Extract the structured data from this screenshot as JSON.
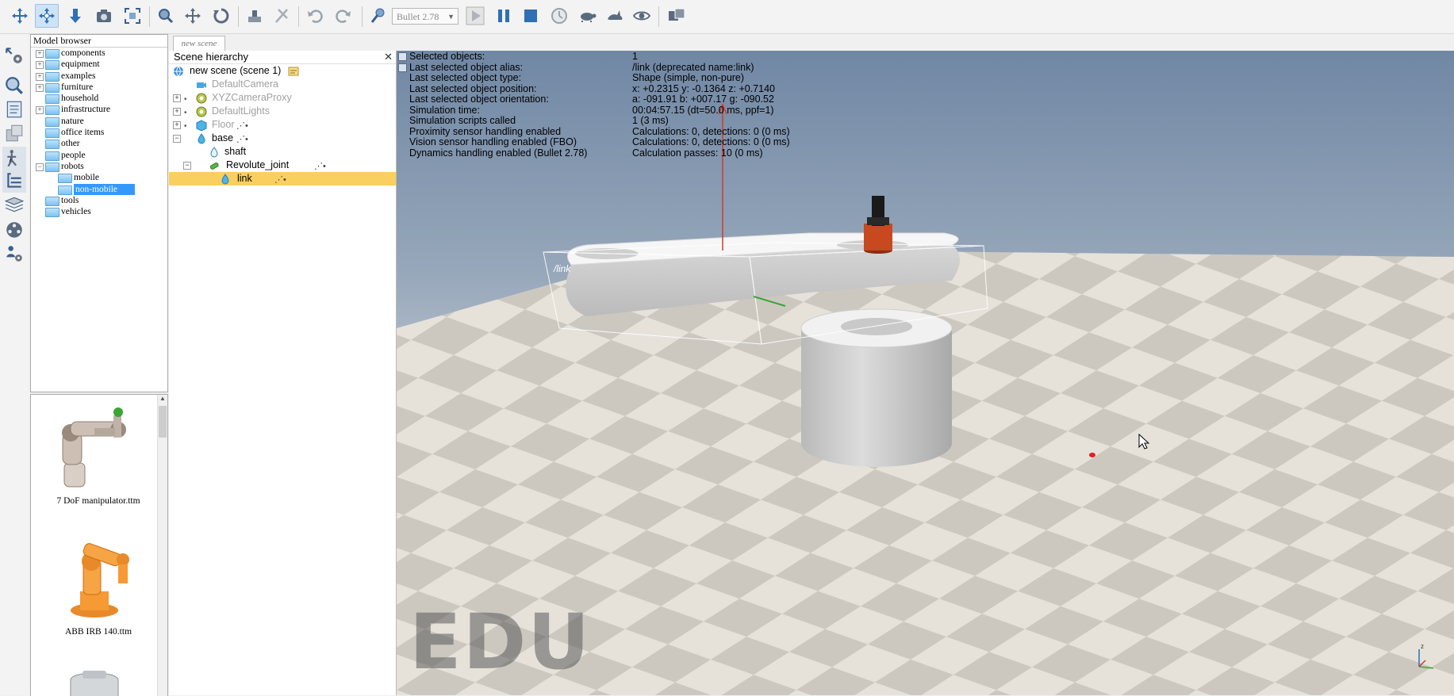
{
  "toolbar": {
    "engine": "Bullet 2.78",
    "buttons": [
      "camera-pan",
      "camera-rotate",
      "camera-shift",
      "camera-zoom",
      "fit-to-view",
      "camera-angle",
      "object-select",
      "object-shift",
      "object-rotate",
      "assemble",
      "transfer-dna",
      "undo",
      "redo",
      "engine-settings",
      "start-simulation",
      "pause-simulation",
      "stop-simulation",
      "realtime",
      "slow-down",
      "speed-up",
      "thread-rendering",
      "toggle-visualization"
    ]
  },
  "model_browser": {
    "title": "Model browser",
    "folders": [
      {
        "label": "components",
        "expandable": true,
        "indent": 0
      },
      {
        "label": "equipment",
        "expandable": true,
        "indent": 0
      },
      {
        "label": "examples",
        "expandable": true,
        "indent": 0
      },
      {
        "label": "furniture",
        "expandable": true,
        "indent": 0
      },
      {
        "label": "household",
        "expandable": false,
        "indent": 0
      },
      {
        "label": "infrastructure",
        "expandable": true,
        "indent": 0
      },
      {
        "label": "nature",
        "expandable": false,
        "indent": 0
      },
      {
        "label": "office items",
        "expandable": false,
        "indent": 0
      },
      {
        "label": "other",
        "expandable": false,
        "indent": 0
      },
      {
        "label": "people",
        "expandable": false,
        "indent": 0
      },
      {
        "label": "robots",
        "expandable": true,
        "expanded": true,
        "indent": 0
      },
      {
        "label": "mobile",
        "expandable": false,
        "indent": 1
      },
      {
        "label": "non-mobile",
        "expandable": false,
        "indent": 1,
        "selected": true
      },
      {
        "label": "tools",
        "expandable": false,
        "indent": 0
      },
      {
        "label": "vehicles",
        "expandable": false,
        "indent": 0
      }
    ],
    "thumbnails": [
      "7 DoF manipulator.ttm",
      "ABB IRB 140.ttm"
    ]
  },
  "scene": {
    "tab_label": "new scene",
    "hierarchy_title": "Scene hierarchy",
    "close_symbol": "✕",
    "root": "new scene (scene 1)",
    "objects": {
      "camera": "DefaultCamera",
      "camera_proxy": "XYZCameraProxy",
      "lights": "DefaultLights",
      "floor": "Floor",
      "base": "base",
      "shaft": "shaft",
      "joint": "Revolute_joint",
      "link": "link"
    }
  },
  "info_overlay": [
    {
      "key": "Selected objects:",
      "value": "1"
    },
    {
      "key": "Last selected object alias:",
      "value": "/link    (deprecated name:link)"
    },
    {
      "key": "Last selected object type:",
      "value": "Shape (simple, non-pure)"
    },
    {
      "key": "Last selected object position:",
      "value": "x: +0.2315    y: -0.1364    z: +0.7140"
    },
    {
      "key": "Last selected object orientation:",
      "value": "a: -091.91    b: +007.17    g: -090.52"
    },
    {
      "key": "Simulation time:",
      "value": "00:04:57.15 (dt=50.0 ms, ppf=1)"
    },
    {
      "key": "Simulation scripts called",
      "value": "1 (3 ms)"
    },
    {
      "key": "Proximity sensor handling enabled",
      "value": "Calculations: 0, detections: 0 (0 ms)"
    },
    {
      "key": "Vision sensor handling enabled (FBO)",
      "value": "Calculations: 0, detections: 0 (0 ms)"
    },
    {
      "key": "Dynamics handling enabled (Bullet 2.78)",
      "value": "Calculation passes: 10 (0 ms)"
    }
  ],
  "viewport": {
    "selection_label": "/link",
    "watermark": "EDU",
    "axis_labels": {
      "z": "z",
      "x": "x",
      "y": "y"
    }
  },
  "colors": {
    "selection": "#f9cf5f",
    "folder_selected": "#3399ff",
    "sky_top": "#7087a4",
    "floor_light": "#e6e2da",
    "floor_dark": "#c9c5bd"
  }
}
